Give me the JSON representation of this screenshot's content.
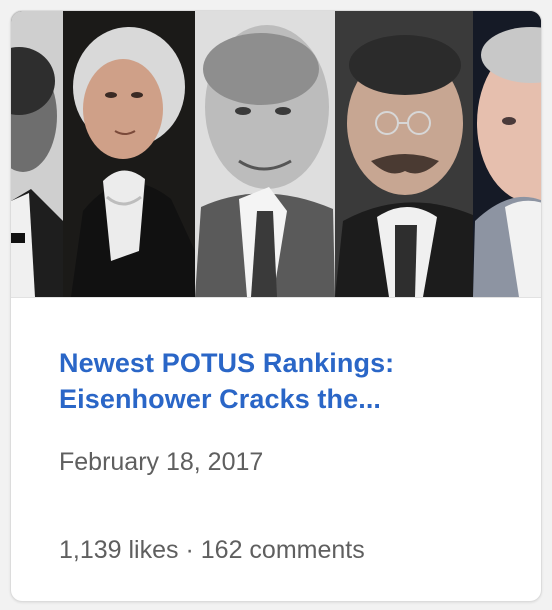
{
  "card": {
    "title": "Newest POTUS Rankings: Eisenhower Cracks the...",
    "date": "February 18, 2017",
    "likes": "1,139 likes",
    "separator": "·",
    "comments": "162 comments"
  },
  "colors": {
    "title": "#2a66c7",
    "secondary_text": "#5f5f5f",
    "card_background": "#ffffff",
    "page_background": "#f2f2f2"
  }
}
